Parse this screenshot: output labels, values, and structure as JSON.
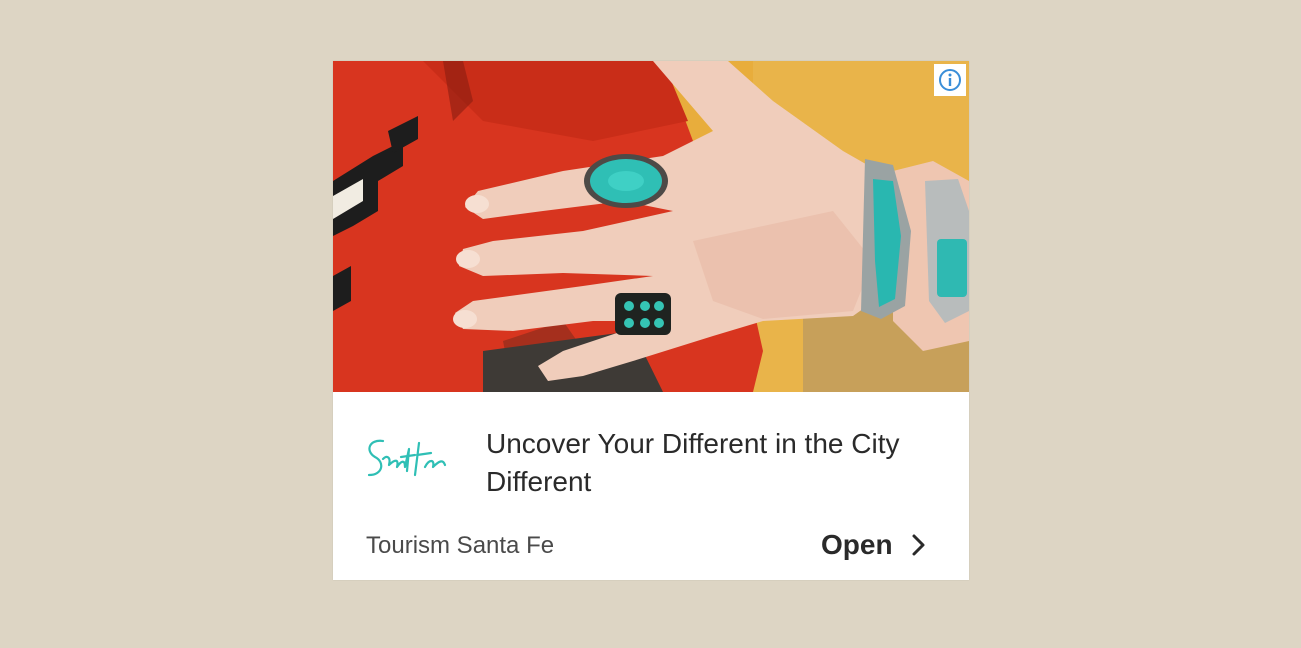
{
  "ad": {
    "headline": "Uncover Your Different in the City Different",
    "advertiser": "Tourism Santa Fe",
    "cta_label": "Open",
    "logo_text": "Santa Fe",
    "icons": {
      "info": "info-icon",
      "cta": "chevron-right-icon"
    },
    "colors": {
      "page_bg": "#ddd5c4",
      "card_bg": "#ffffff",
      "accent_turquoise": "#2fbfb5",
      "info_blue": "#3a8ed8"
    }
  }
}
